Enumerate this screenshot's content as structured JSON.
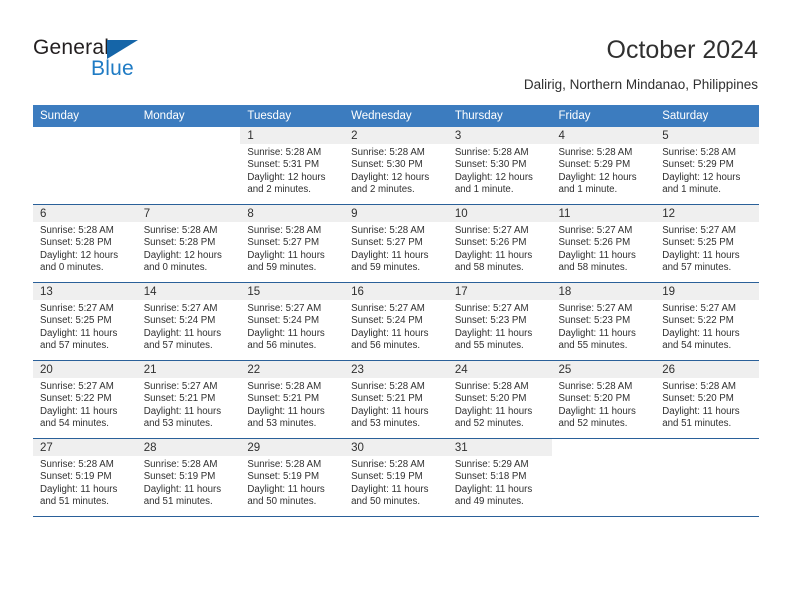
{
  "brand": {
    "name_part1": "General",
    "name_part2": "Blue",
    "triangle_color": "#1565a8",
    "blue_text_color": "#1f7bc4"
  },
  "header": {
    "title": "October 2024",
    "subtitle": "Dalirig, Northern Mindanao, Philippines"
  },
  "colors": {
    "header_row_bg": "#3c7cbf",
    "row_rule": "#2a6099",
    "date_band_bg": "#efefef",
    "text": "#303030"
  },
  "weekdays": [
    "Sunday",
    "Monday",
    "Tuesday",
    "Wednesday",
    "Thursday",
    "Friday",
    "Saturday"
  ],
  "weeks": [
    [
      {
        "empty": true
      },
      {
        "empty": true
      },
      {
        "day": "1",
        "sunrise": "Sunrise: 5:28 AM",
        "sunset": "Sunset: 5:31 PM",
        "daylight1": "Daylight: 12 hours",
        "daylight2": "and 2 minutes."
      },
      {
        "day": "2",
        "sunrise": "Sunrise: 5:28 AM",
        "sunset": "Sunset: 5:30 PM",
        "daylight1": "Daylight: 12 hours",
        "daylight2": "and 2 minutes."
      },
      {
        "day": "3",
        "sunrise": "Sunrise: 5:28 AM",
        "sunset": "Sunset: 5:30 PM",
        "daylight1": "Daylight: 12 hours",
        "daylight2": "and 1 minute."
      },
      {
        "day": "4",
        "sunrise": "Sunrise: 5:28 AM",
        "sunset": "Sunset: 5:29 PM",
        "daylight1": "Daylight: 12 hours",
        "daylight2": "and 1 minute."
      },
      {
        "day": "5",
        "sunrise": "Sunrise: 5:28 AM",
        "sunset": "Sunset: 5:29 PM",
        "daylight1": "Daylight: 12 hours",
        "daylight2": "and 1 minute."
      }
    ],
    [
      {
        "day": "6",
        "sunrise": "Sunrise: 5:28 AM",
        "sunset": "Sunset: 5:28 PM",
        "daylight1": "Daylight: 12 hours",
        "daylight2": "and 0 minutes."
      },
      {
        "day": "7",
        "sunrise": "Sunrise: 5:28 AM",
        "sunset": "Sunset: 5:28 PM",
        "daylight1": "Daylight: 12 hours",
        "daylight2": "and 0 minutes."
      },
      {
        "day": "8",
        "sunrise": "Sunrise: 5:28 AM",
        "sunset": "Sunset: 5:27 PM",
        "daylight1": "Daylight: 11 hours",
        "daylight2": "and 59 minutes."
      },
      {
        "day": "9",
        "sunrise": "Sunrise: 5:28 AM",
        "sunset": "Sunset: 5:27 PM",
        "daylight1": "Daylight: 11 hours",
        "daylight2": "and 59 minutes."
      },
      {
        "day": "10",
        "sunrise": "Sunrise: 5:27 AM",
        "sunset": "Sunset: 5:26 PM",
        "daylight1": "Daylight: 11 hours",
        "daylight2": "and 58 minutes."
      },
      {
        "day": "11",
        "sunrise": "Sunrise: 5:27 AM",
        "sunset": "Sunset: 5:26 PM",
        "daylight1": "Daylight: 11 hours",
        "daylight2": "and 58 minutes."
      },
      {
        "day": "12",
        "sunrise": "Sunrise: 5:27 AM",
        "sunset": "Sunset: 5:25 PM",
        "daylight1": "Daylight: 11 hours",
        "daylight2": "and 57 minutes."
      }
    ],
    [
      {
        "day": "13",
        "sunrise": "Sunrise: 5:27 AM",
        "sunset": "Sunset: 5:25 PM",
        "daylight1": "Daylight: 11 hours",
        "daylight2": "and 57 minutes."
      },
      {
        "day": "14",
        "sunrise": "Sunrise: 5:27 AM",
        "sunset": "Sunset: 5:24 PM",
        "daylight1": "Daylight: 11 hours",
        "daylight2": "and 57 minutes."
      },
      {
        "day": "15",
        "sunrise": "Sunrise: 5:27 AM",
        "sunset": "Sunset: 5:24 PM",
        "daylight1": "Daylight: 11 hours",
        "daylight2": "and 56 minutes."
      },
      {
        "day": "16",
        "sunrise": "Sunrise: 5:27 AM",
        "sunset": "Sunset: 5:24 PM",
        "daylight1": "Daylight: 11 hours",
        "daylight2": "and 56 minutes."
      },
      {
        "day": "17",
        "sunrise": "Sunrise: 5:27 AM",
        "sunset": "Sunset: 5:23 PM",
        "daylight1": "Daylight: 11 hours",
        "daylight2": "and 55 minutes."
      },
      {
        "day": "18",
        "sunrise": "Sunrise: 5:27 AM",
        "sunset": "Sunset: 5:23 PM",
        "daylight1": "Daylight: 11 hours",
        "daylight2": "and 55 minutes."
      },
      {
        "day": "19",
        "sunrise": "Sunrise: 5:27 AM",
        "sunset": "Sunset: 5:22 PM",
        "daylight1": "Daylight: 11 hours",
        "daylight2": "and 54 minutes."
      }
    ],
    [
      {
        "day": "20",
        "sunrise": "Sunrise: 5:27 AM",
        "sunset": "Sunset: 5:22 PM",
        "daylight1": "Daylight: 11 hours",
        "daylight2": "and 54 minutes."
      },
      {
        "day": "21",
        "sunrise": "Sunrise: 5:27 AM",
        "sunset": "Sunset: 5:21 PM",
        "daylight1": "Daylight: 11 hours",
        "daylight2": "and 53 minutes."
      },
      {
        "day": "22",
        "sunrise": "Sunrise: 5:28 AM",
        "sunset": "Sunset: 5:21 PM",
        "daylight1": "Daylight: 11 hours",
        "daylight2": "and 53 minutes."
      },
      {
        "day": "23",
        "sunrise": "Sunrise: 5:28 AM",
        "sunset": "Sunset: 5:21 PM",
        "daylight1": "Daylight: 11 hours",
        "daylight2": "and 53 minutes."
      },
      {
        "day": "24",
        "sunrise": "Sunrise: 5:28 AM",
        "sunset": "Sunset: 5:20 PM",
        "daylight1": "Daylight: 11 hours",
        "daylight2": "and 52 minutes."
      },
      {
        "day": "25",
        "sunrise": "Sunrise: 5:28 AM",
        "sunset": "Sunset: 5:20 PM",
        "daylight1": "Daylight: 11 hours",
        "daylight2": "and 52 minutes."
      },
      {
        "day": "26",
        "sunrise": "Sunrise: 5:28 AM",
        "sunset": "Sunset: 5:20 PM",
        "daylight1": "Daylight: 11 hours",
        "daylight2": "and 51 minutes."
      }
    ],
    [
      {
        "day": "27",
        "sunrise": "Sunrise: 5:28 AM",
        "sunset": "Sunset: 5:19 PM",
        "daylight1": "Daylight: 11 hours",
        "daylight2": "and 51 minutes."
      },
      {
        "day": "28",
        "sunrise": "Sunrise: 5:28 AM",
        "sunset": "Sunset: 5:19 PM",
        "daylight1": "Daylight: 11 hours",
        "daylight2": "and 51 minutes."
      },
      {
        "day": "29",
        "sunrise": "Sunrise: 5:28 AM",
        "sunset": "Sunset: 5:19 PM",
        "daylight1": "Daylight: 11 hours",
        "daylight2": "and 50 minutes."
      },
      {
        "day": "30",
        "sunrise": "Sunrise: 5:28 AM",
        "sunset": "Sunset: 5:19 PM",
        "daylight1": "Daylight: 11 hours",
        "daylight2": "and 50 minutes."
      },
      {
        "day": "31",
        "sunrise": "Sunrise: 5:29 AM",
        "sunset": "Sunset: 5:18 PM",
        "daylight1": "Daylight: 11 hours",
        "daylight2": "and 49 minutes."
      },
      {
        "empty": true
      },
      {
        "empty": true
      }
    ]
  ]
}
